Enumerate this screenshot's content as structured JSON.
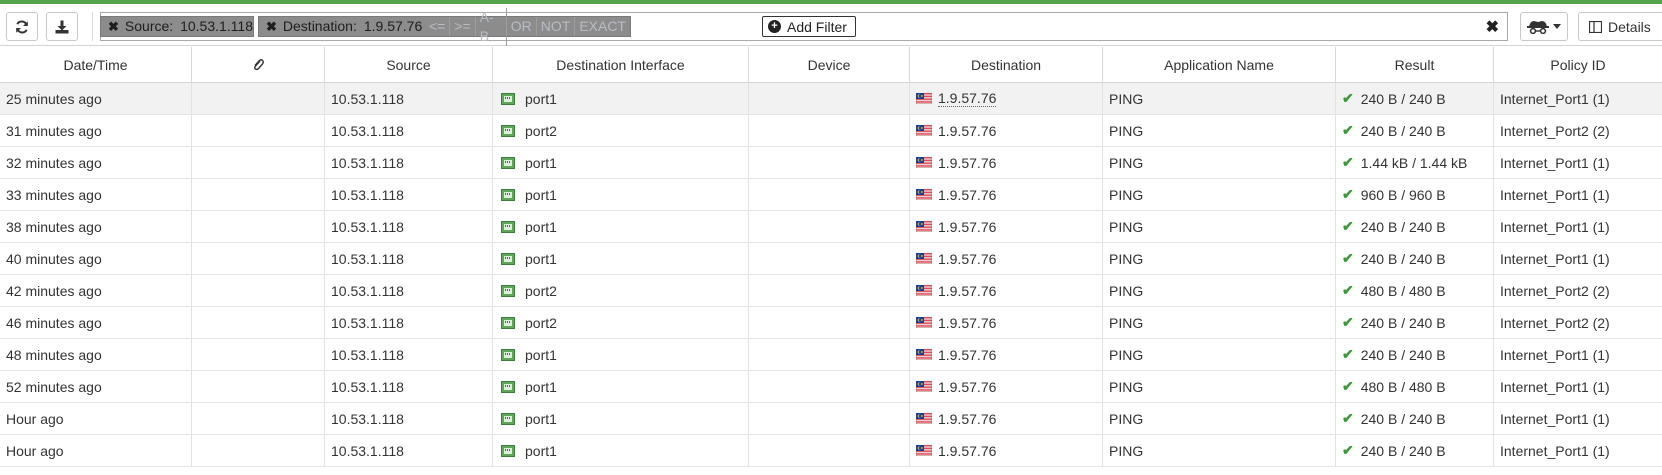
{
  "toolbar": {
    "refresh_icon": "refresh-icon",
    "download_icon": "download-icon",
    "details_label": "Details",
    "display_mode_icon": "spy-icon"
  },
  "filter": {
    "chips": [
      {
        "key": "Source:",
        "value": "10.53.1.118"
      },
      {
        "key": "Destination:",
        "value": "1.9.57.76"
      }
    ],
    "operators": [
      "<=",
      ">=",
      "A-B",
      "OR",
      "NOT",
      "EXACT"
    ],
    "add_filter_label": "Add Filter",
    "clear_label": "✖"
  },
  "table": {
    "columns": [
      "Date/Time",
      "",
      "Source",
      "Destination Interface",
      "Device",
      "Destination",
      "Application Name",
      "Result",
      "Policy ID"
    ],
    "rows": [
      {
        "time": "25 minutes ago",
        "source": "10.53.1.118",
        "iface": "port1",
        "device": "",
        "dest": "1.9.57.76",
        "app": "PING",
        "result": "240 B / 240 B",
        "policy": "Internet_Port1 (1)"
      },
      {
        "time": "31 minutes ago",
        "source": "10.53.1.118",
        "iface": "port2",
        "device": "",
        "dest": "1.9.57.76",
        "app": "PING",
        "result": "240 B / 240 B",
        "policy": "Internet_Port2 (2)"
      },
      {
        "time": "32 minutes ago",
        "source": "10.53.1.118",
        "iface": "port1",
        "device": "",
        "dest": "1.9.57.76",
        "app": "PING",
        "result": "1.44 kB / 1.44 kB",
        "policy": "Internet_Port1 (1)"
      },
      {
        "time": "33 minutes ago",
        "source": "10.53.1.118",
        "iface": "port1",
        "device": "",
        "dest": "1.9.57.76",
        "app": "PING",
        "result": "960 B / 960 B",
        "policy": "Internet_Port1 (1)"
      },
      {
        "time": "38 minutes ago",
        "source": "10.53.1.118",
        "iface": "port1",
        "device": "",
        "dest": "1.9.57.76",
        "app": "PING",
        "result": "240 B / 240 B",
        "policy": "Internet_Port1 (1)"
      },
      {
        "time": "40 minutes ago",
        "source": "10.53.1.118",
        "iface": "port1",
        "device": "",
        "dest": "1.9.57.76",
        "app": "PING",
        "result": "240 B / 240 B",
        "policy": "Internet_Port1 (1)"
      },
      {
        "time": "42 minutes ago",
        "source": "10.53.1.118",
        "iface": "port2",
        "device": "",
        "dest": "1.9.57.76",
        "app": "PING",
        "result": "480 B / 480 B",
        "policy": "Internet_Port2 (2)"
      },
      {
        "time": "46 minutes ago",
        "source": "10.53.1.118",
        "iface": "port2",
        "device": "",
        "dest": "1.9.57.76",
        "app": "PING",
        "result": "240 B / 240 B",
        "policy": "Internet_Port2 (2)"
      },
      {
        "time": "48 minutes ago",
        "source": "10.53.1.118",
        "iface": "port1",
        "device": "",
        "dest": "1.9.57.76",
        "app": "PING",
        "result": "240 B / 240 B",
        "policy": "Internet_Port1 (1)"
      },
      {
        "time": "52 minutes ago",
        "source": "10.53.1.118",
        "iface": "port1",
        "device": "",
        "dest": "1.9.57.76",
        "app": "PING",
        "result": "480 B / 480 B",
        "policy": "Internet_Port1 (1)"
      },
      {
        "time": "Hour ago",
        "source": "10.53.1.118",
        "iface": "port1",
        "device": "",
        "dest": "1.9.57.76",
        "app": "PING",
        "result": "240 B / 240 B",
        "policy": "Internet_Port1 (1)"
      },
      {
        "time": "Hour ago",
        "source": "10.53.1.118",
        "iface": "port1",
        "device": "",
        "dest": "1.9.57.76",
        "app": "PING",
        "result": "240 B / 240 B",
        "policy": "Internet_Port1 (1)"
      }
    ]
  },
  "colors": {
    "accent": "#55a34a",
    "success": "#3a9a3a",
    "chip": "#8c8c8c"
  }
}
